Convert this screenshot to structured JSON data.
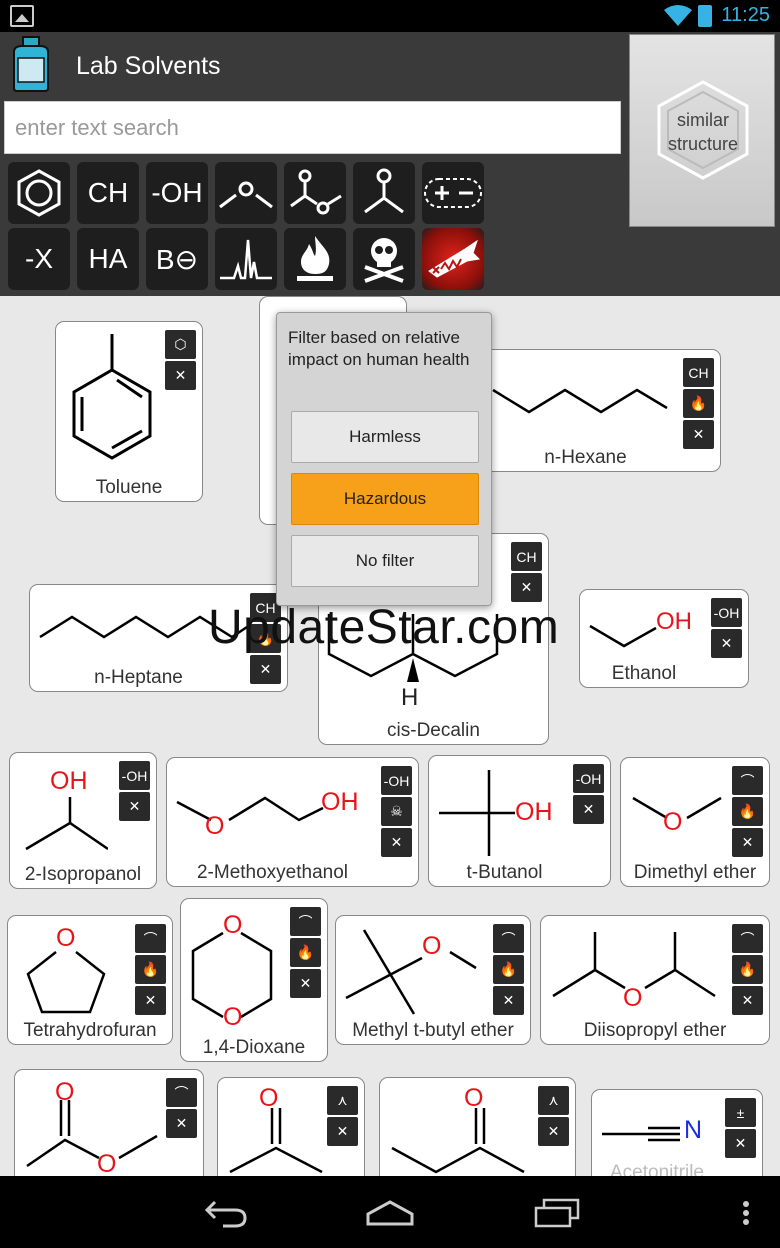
{
  "app": {
    "title": "Lab Solvents"
  },
  "status": {
    "time": "11:25"
  },
  "search": {
    "placeholder": "enter text search"
  },
  "similar": {
    "line1": "similar",
    "line2": "structure"
  },
  "filters": {
    "row1": [
      {
        "name": "aromatic",
        "icon": "benzene-ring-icon",
        "label": ""
      },
      {
        "name": "hydrocarbon",
        "icon": "text",
        "label": "CH"
      },
      {
        "name": "alcohol",
        "icon": "text",
        "label": "-OH"
      },
      {
        "name": "ether",
        "icon": "ether-icon",
        "label": ""
      },
      {
        "name": "ester",
        "icon": "ester-icon",
        "label": ""
      },
      {
        "name": "ketone",
        "icon": "ketone-icon",
        "label": ""
      },
      {
        "name": "polar-aprotic",
        "icon": "plus-minus-icon",
        "label": ""
      }
    ],
    "row2": [
      {
        "name": "halogenated",
        "icon": "text",
        "label": "-X"
      },
      {
        "name": "acid",
        "icon": "text",
        "label": "HA"
      },
      {
        "name": "base",
        "icon": "text",
        "label": "B⊖"
      },
      {
        "name": "spectrum",
        "icon": "nmr-peaks-icon",
        "label": ""
      },
      {
        "name": "flammable",
        "icon": "flame-icon",
        "label": ""
      },
      {
        "name": "toxic",
        "icon": "skull-crossbones-icon",
        "label": ""
      },
      {
        "name": "environment",
        "icon": "dead-fish-icon",
        "label": ""
      }
    ]
  },
  "popup": {
    "message": "Filter based on relative impact on human health",
    "options": [
      "Harmless",
      "Hazardous",
      "No filter"
    ],
    "selected": "Hazardous"
  },
  "solvents": {
    "toluene": {
      "name": "Toluene",
      "badges": [
        "aromatic",
        "environment"
      ]
    },
    "hexane": {
      "name": "n-Hexane",
      "badges": [
        "CH",
        "flammable",
        "environment"
      ]
    },
    "heptane": {
      "name": "n-Heptane",
      "badges": [
        "CH",
        "flammable",
        "environment"
      ]
    },
    "decalin": {
      "name": "cis-Decalin",
      "badges": [
        "CH",
        "environment"
      ]
    },
    "ethanol": {
      "name": "Ethanol",
      "badges": [
        "-OH",
        "environment"
      ]
    },
    "isopropanol": {
      "name": "2-Isopropanol",
      "badges": [
        "-OH",
        "environment"
      ]
    },
    "methoxyethanol": {
      "name": "2-Methoxyethanol",
      "badges": [
        "-OH",
        "toxic",
        "environment"
      ]
    },
    "butanol": {
      "name": "t-Butanol",
      "badges": [
        "-OH",
        "environment"
      ]
    },
    "dimethylether": {
      "name": "Dimethyl ether",
      "badges": [
        "ether",
        "flammable",
        "environment"
      ]
    },
    "thf": {
      "name": "Tetrahydrofuran",
      "badges": [
        "ether",
        "flammable",
        "environment"
      ]
    },
    "dioxane": {
      "name": "1,4-Dioxane",
      "badges": [
        "ether",
        "flammable",
        "environment"
      ]
    },
    "mtbe": {
      "name": "Methyl t-butyl ether",
      "badges": [
        "ether",
        "flammable",
        "environment"
      ]
    },
    "dipe": {
      "name": "Diisopropyl ether",
      "badges": [
        "ether",
        "flammable",
        "environment"
      ]
    },
    "acetonitrile": {
      "name": "Acetonitrile",
      "badges": [
        "polar-aprotic",
        "environment"
      ]
    }
  },
  "atoms": {
    "oh": "OH",
    "o": "O",
    "n": "N",
    "h": "H"
  },
  "watermark": "UpdateStar.com",
  "colors": {
    "atom_red": "#e8141b",
    "atom_blue": "#1a2ee8",
    "active": "#f7a11a"
  }
}
